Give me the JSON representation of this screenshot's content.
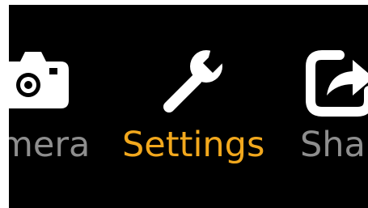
{
  "menu": {
    "items": [
      {
        "label": "mera",
        "icon": "camera-icon",
        "state": "partial"
      },
      {
        "label": "Settings",
        "icon": "wrench-icon",
        "state": "selected"
      },
      {
        "label": "Shar",
        "icon": "share-icon",
        "state": "partial"
      }
    ],
    "colors": {
      "background": "#000000",
      "selected": "#f2a81d",
      "unselected": "#8e8e8e",
      "icon": "#ffffff"
    }
  }
}
